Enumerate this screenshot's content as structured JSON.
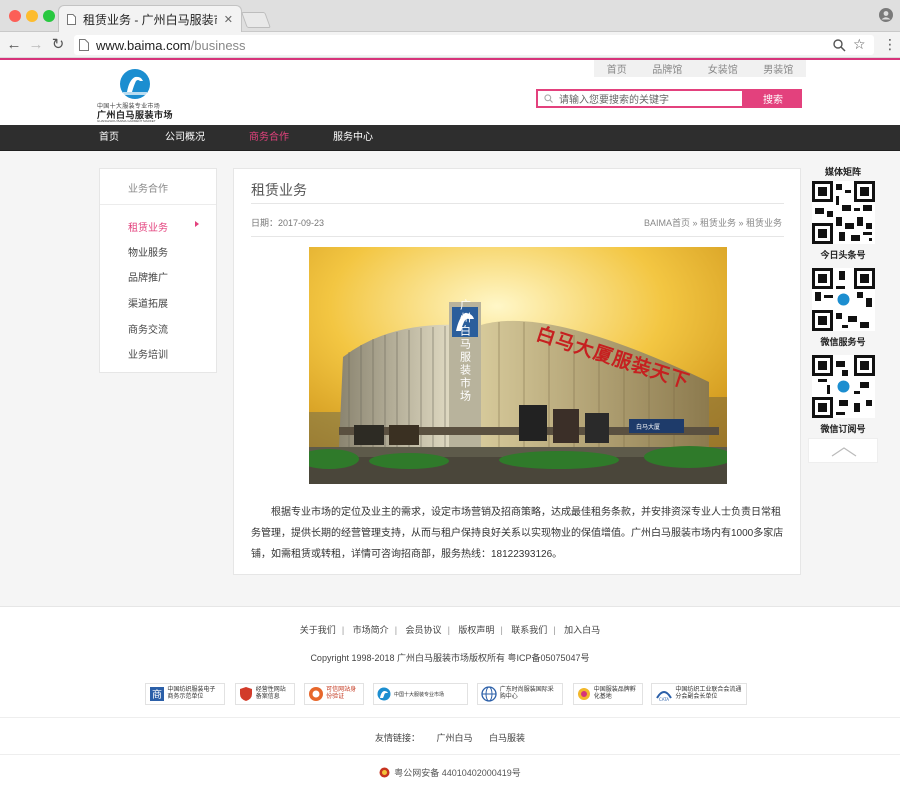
{
  "browser": {
    "tab_title": "租赁业务 - 广州白马服装市场官方网站",
    "url_host": "www.baima.com",
    "url_path": "/business"
  },
  "header": {
    "logo_sub": "中国十大服装专业市场",
    "logo_name": "广州白马服装市场",
    "logo_en": "GUANGZHOU BAIMA GARMENT MARKET",
    "top_links": [
      "首页",
      "品牌馆",
      "女装馆",
      "男装馆"
    ],
    "search_placeholder": "请输入您要搜索的关键字",
    "search_button": "搜索"
  },
  "nav": {
    "items": [
      "首页",
      "公司概况",
      "商务合作",
      "服务中心"
    ],
    "active": "商务合作"
  },
  "sidebar": {
    "title": "业务合作",
    "items": [
      "租赁业务",
      "物业服务",
      "品牌推广",
      "渠道拓展",
      "商务交流",
      "业务培训"
    ],
    "active": "租赁业务"
  },
  "article": {
    "title": "租赁业务",
    "date": "日期：2017-09-23",
    "breadcrumb": "BAIMA首页 » 租赁业务 » 租赁业务",
    "image_sign_main": "白马大厦服装天下",
    "image_sign_vertical": "广州白马服装市场",
    "image_sign_small": "白马大厦",
    "body": "根据专业市场的定位及业主的需求，设定市场营销及招商策略，达成最佳租务条款，并安排资深专业人士负责日常租务管理，提供长期的经营管理支持，从而与租户保持良好关系以实现物业的保值增值。广州白马服装市场内有1000多家店铺，如需租赁或转租，详情可咨询招商部，服务热线：18122393126。"
  },
  "media": {
    "title": "媒体矩阵",
    "items": [
      "今日头条号",
      "微信服务号",
      "微信订阅号"
    ]
  },
  "footer": {
    "links": [
      "关于我们",
      "市场简介",
      "会员协议",
      "版权声明",
      "联系我们",
      "加入白马"
    ],
    "copyright": "Copyright 1998-2018 广州白马服装市场版权所有 粤ICP备05075047号",
    "badges": [
      "中国纺织服装电子商务示范单位",
      "经营性网站备案信息",
      "可信网站身份验证",
      "中国十大服装专业市场",
      "广东时尚服装国际采购中心",
      "中国服装品牌孵化基地",
      "中国纺织工业联合会流通分会副会长单位"
    ],
    "friend_label": "友情链接：",
    "friend_links": [
      "广州白马",
      "白马服装"
    ],
    "police": "粤公网安备 44010402000419号"
  },
  "colors": {
    "accent": "#e3417d",
    "nav_bg": "#2e2e2e"
  }
}
